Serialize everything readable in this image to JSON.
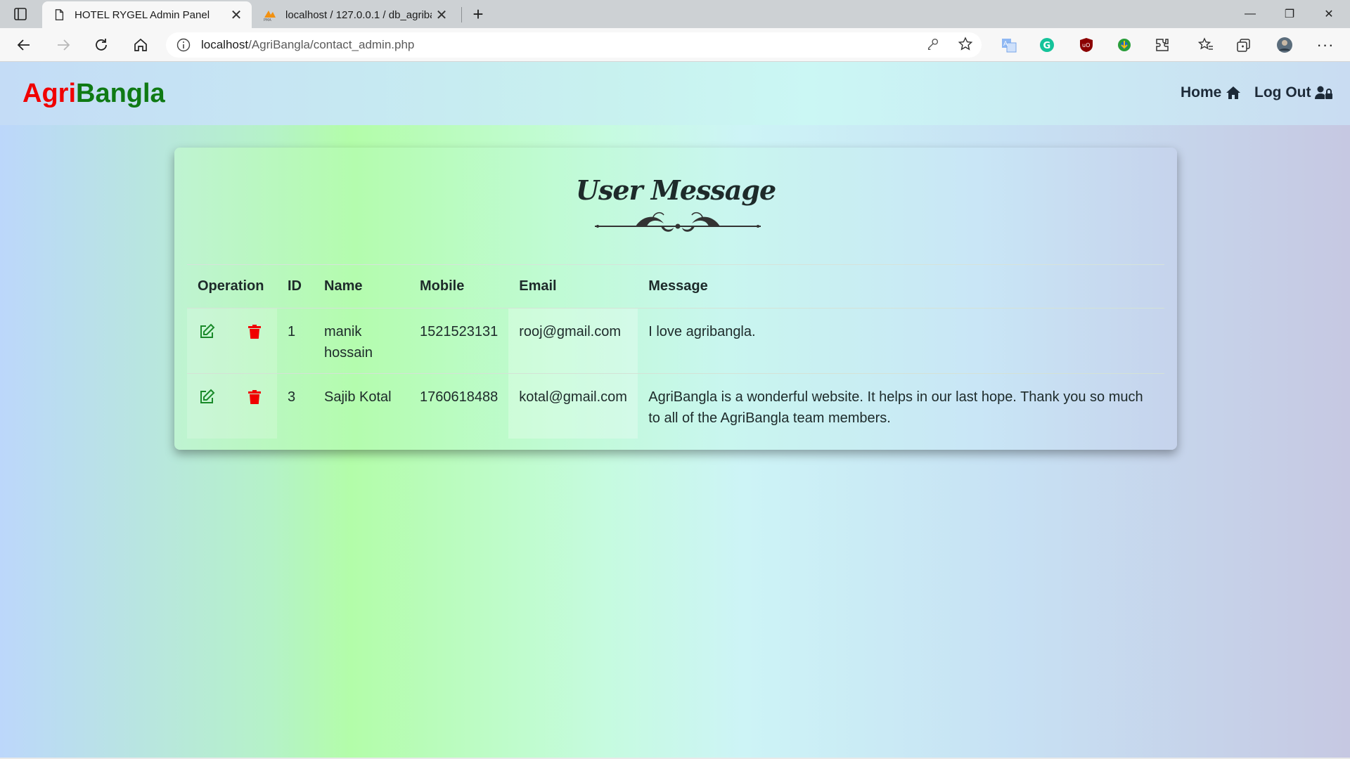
{
  "browser": {
    "tabs": [
      {
        "title": "HOTEL RYGEL Admin Panel",
        "active": true
      },
      {
        "title": "localhost / 127.0.0.1 / db_agribangla",
        "active": false
      }
    ],
    "address": {
      "host": "localhost",
      "path": "/AgriBangla/contact_admin.php"
    }
  },
  "navbar": {
    "brand_part1": "Agri",
    "brand_part2": "Bangla",
    "links": [
      {
        "label": "Home",
        "icon": "home-icon"
      },
      {
        "label": "Log Out",
        "icon": "user-lock-icon"
      }
    ]
  },
  "card": {
    "title": "User Message",
    "columns": [
      "Operation",
      "ID",
      "Name",
      "Mobile",
      "Email",
      "Message"
    ],
    "rows": [
      {
        "id": "1",
        "name": "manik hossain",
        "mobile": "1521523131",
        "email": "rooj@gmail.com",
        "message": "I love agribangla."
      },
      {
        "id": "3",
        "name": "Sajib Kotal",
        "mobile": "1760618488",
        "email": "kotal@gmail.com",
        "message": "AgriBangla is a wonderful website. It helps in our last hope. Thank you so much to all of the AgriBangla team members."
      }
    ]
  },
  "colors": {
    "brand_red": "#f00000",
    "brand_green": "#0f7a14",
    "edit_green": "#1a8a2a",
    "delete_red": "#f00000"
  }
}
